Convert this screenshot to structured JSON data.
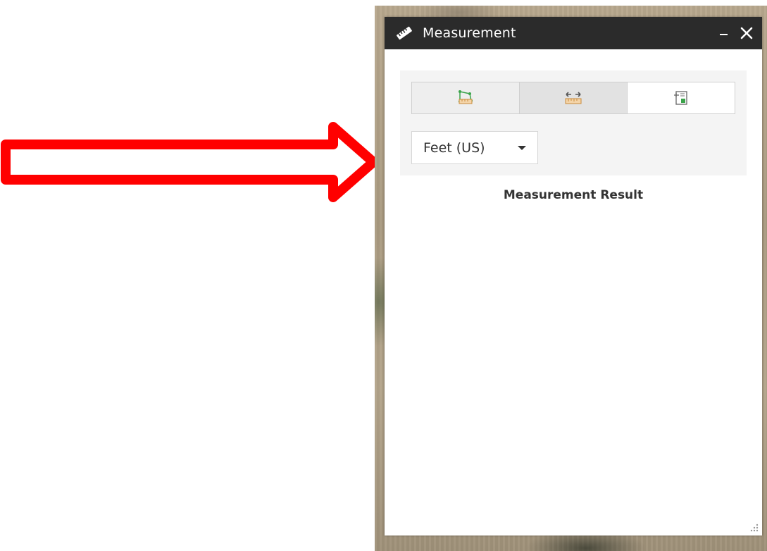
{
  "colors": {
    "arrow": "#ff0000",
    "titlebar": "#2b2b2b",
    "panel": "#ffffff",
    "tool_area": "#f4f4f4"
  },
  "widget": {
    "title": "Measurement",
    "title_icon": "ruler-icon",
    "minimize_icon": "minimize-icon",
    "close_icon": "close-icon"
  },
  "tools": [
    {
      "name": "area",
      "icon": "area-measure-icon"
    },
    {
      "name": "distance",
      "icon": "distance-measure-icon",
      "selected": true
    },
    {
      "name": "location",
      "icon": "location-measure-icon"
    }
  ],
  "units": {
    "selected": "Feet (US)"
  },
  "result": {
    "label": "Measurement Result"
  }
}
